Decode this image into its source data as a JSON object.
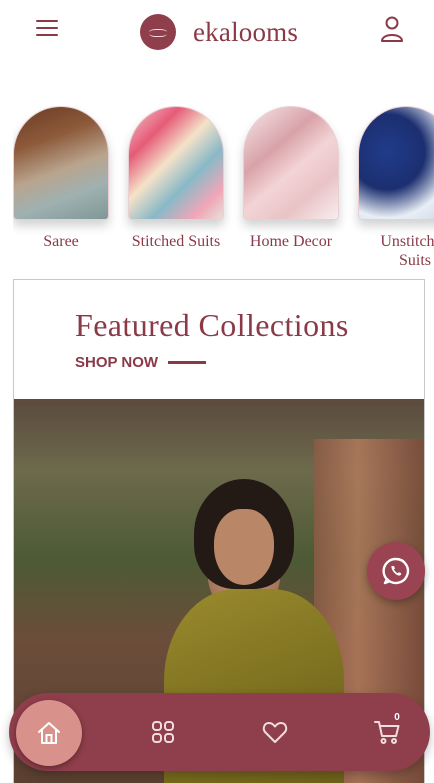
{
  "header": {
    "brand": "ekalooms",
    "menu_icon": "hamburger-menu-icon",
    "account_icon": "user-icon"
  },
  "categories": [
    {
      "label": "Saree"
    },
    {
      "label": "Stitched Suits"
    },
    {
      "label": "Home Decor"
    },
    {
      "label": "Unstitched Suits"
    }
  ],
  "featured": {
    "title": "Featured Collections",
    "cta": "SHOP NOW"
  },
  "bottom_nav": {
    "items": [
      "home-icon",
      "grid-icon",
      "heart-icon",
      "cart-icon"
    ],
    "cart_count": "0"
  },
  "colors": {
    "brand": "#8a3a47",
    "nav_bg": "#8f3e4b",
    "home_active": "#d9928b",
    "whatsapp_bg": "#9a4352"
  }
}
